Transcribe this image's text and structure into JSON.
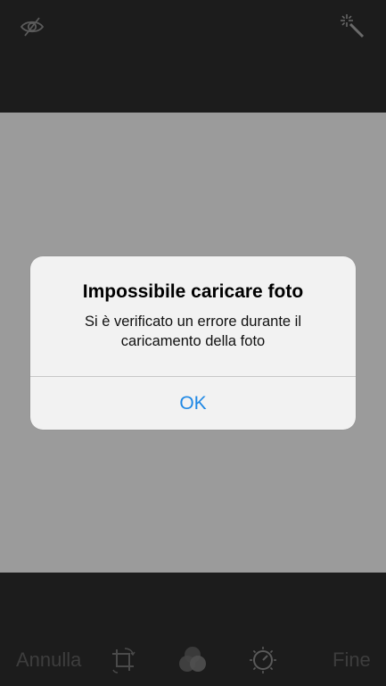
{
  "top_bar": {
    "hide_icon": "eye-slash-icon",
    "auto_enhance_icon": "magic-wand-icon"
  },
  "alert": {
    "title": "Impossibile caricare foto",
    "message": "Si è verificato un errore durante il caricamento della foto",
    "ok_label": "OK"
  },
  "toolbar": {
    "cancel_label": "Annulla",
    "done_label": "Fine",
    "crop_icon": "crop-rotate-icon",
    "filters_icon": "filters-icon",
    "adjust_icon": "adjust-dial-icon"
  },
  "colors": {
    "accent": "#1e88e5",
    "photo_gray": "#9b9b9b",
    "bar_background": "#1c1c1c",
    "alert_background": "#f2f2f2",
    "disabled_text": "#3d3d3d"
  }
}
